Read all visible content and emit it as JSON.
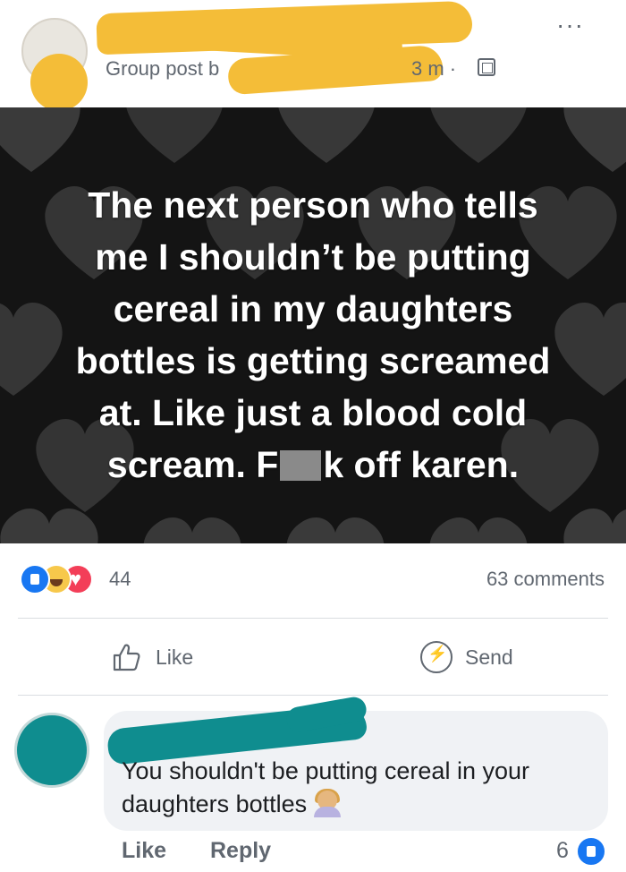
{
  "header": {
    "meta_prefix": "Group post b",
    "time": "3 m ·",
    "more_label": "···"
  },
  "post": {
    "text_lines": [
      "The next person who tells",
      "me I shouldn’t be putting",
      "cereal in my daughters",
      "bottles is getting screamed",
      "at. Like just a blood cold"
    ],
    "last_line_start": "scream. F",
    "last_line_end": "k off karen."
  },
  "stats": {
    "reaction_count": "44",
    "comments": "63 comments"
  },
  "actions": {
    "like": "Like",
    "send": "Send"
  },
  "comment": {
    "text": "You shouldn't be putting cereal in your daughters bottles",
    "like_label": "Like",
    "reply_label": "Reply",
    "like_count": "6"
  },
  "icons": [
    "more-icon",
    "globe-icon",
    "like-reaction-icon",
    "haha-reaction-icon",
    "love-reaction-icon",
    "thumbs-up-icon",
    "messenger-icon",
    "emoji-icon"
  ],
  "colors": {
    "redaction_header": "#f4bd38",
    "redaction_comment": "#0f8d8f",
    "facebook_blue": "#1877f2",
    "post_background": "#141414"
  }
}
